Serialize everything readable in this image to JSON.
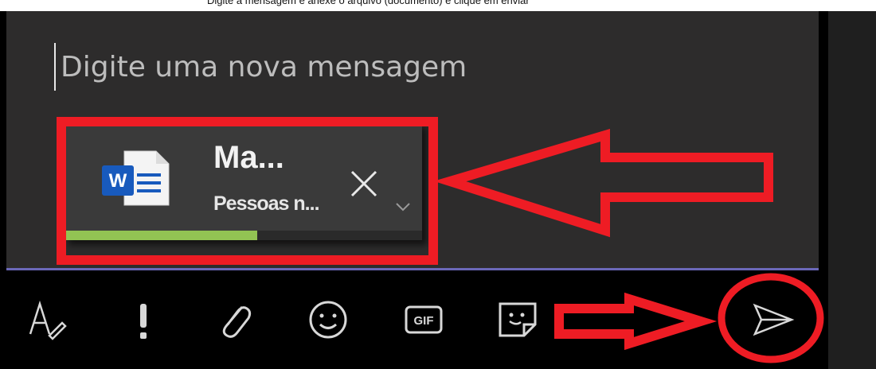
{
  "top_caption": "Digite a mensagem e anexe o arquivo (documento) e clique em enviar",
  "compose": {
    "placeholder": "Digite uma nova mensagem"
  },
  "attachment": {
    "name": "Ma...",
    "subtitle": "Pessoas n...",
    "upload_progress": 0.54,
    "close_icon": "close-icon",
    "expand_icon": "chevron-down-icon",
    "type_icon": "word-file-icon"
  },
  "toolbar": {
    "items": [
      {
        "name": "format-icon"
      },
      {
        "name": "important-icon"
      },
      {
        "name": "attach-icon"
      },
      {
        "name": "emoji-icon"
      },
      {
        "name": "gif-icon",
        "label": "GIF"
      },
      {
        "name": "sticker-icon"
      },
      {
        "name": "send-icon"
      }
    ]
  },
  "colors": {
    "compose_bg": "#2d2c2c",
    "accent_line": "#6b68b8",
    "progress": "#92c353",
    "annotation": "#ee1c24",
    "word_blue": "#185abd"
  }
}
